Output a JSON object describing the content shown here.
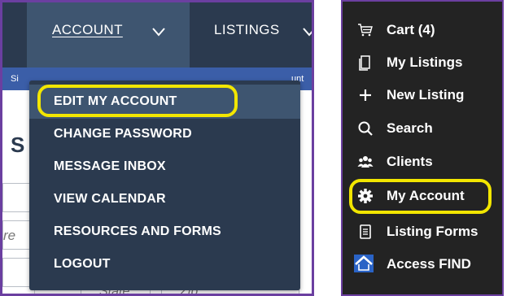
{
  "left_panel": {
    "nav": {
      "account_label": "ACCOUNT",
      "listings_label": "LISTINGS"
    },
    "subbar": {
      "left_text": "Si",
      "right_text": "unt"
    },
    "background_heading": "S",
    "background_field_text": "re",
    "state_placeholder": "State",
    "zip_placeholder": "Zip",
    "dropdown": {
      "items": [
        {
          "label": "EDIT MY ACCOUNT",
          "highlighted": true
        },
        {
          "label": "CHANGE PASSWORD",
          "highlighted": false
        },
        {
          "label": "MESSAGE INBOX",
          "highlighted": false
        },
        {
          "label": "VIEW CALENDAR",
          "highlighted": false
        },
        {
          "label": "RESOURCES AND FORMS",
          "highlighted": false
        },
        {
          "label": "LOGOUT",
          "highlighted": false
        }
      ]
    }
  },
  "right_panel": {
    "menu": [
      {
        "icon": "cart-icon",
        "label": "Cart (4)"
      },
      {
        "icon": "my-listings-icon",
        "label": "My Listings"
      },
      {
        "icon": "plus-icon",
        "label": "New Listing"
      },
      {
        "icon": "search-icon",
        "label": "Search"
      },
      {
        "icon": "clients-icon",
        "label": "Clients"
      },
      {
        "icon": "gear-icon",
        "label": "My Account",
        "highlighted": true
      },
      {
        "icon": "listing-forms-icon",
        "label": "Listing Forms"
      },
      {
        "icon": "house-icon",
        "label": "Access FIND"
      }
    ]
  },
  "colors": {
    "nav_dark": "#2b3a4f",
    "nav_active": "#3e5570",
    "subbar_blue": "#3b5ea8",
    "highlight_yellow": "#f2e600",
    "frame_purple": "#6b3fa0",
    "sidebar_dark": "#232323"
  }
}
